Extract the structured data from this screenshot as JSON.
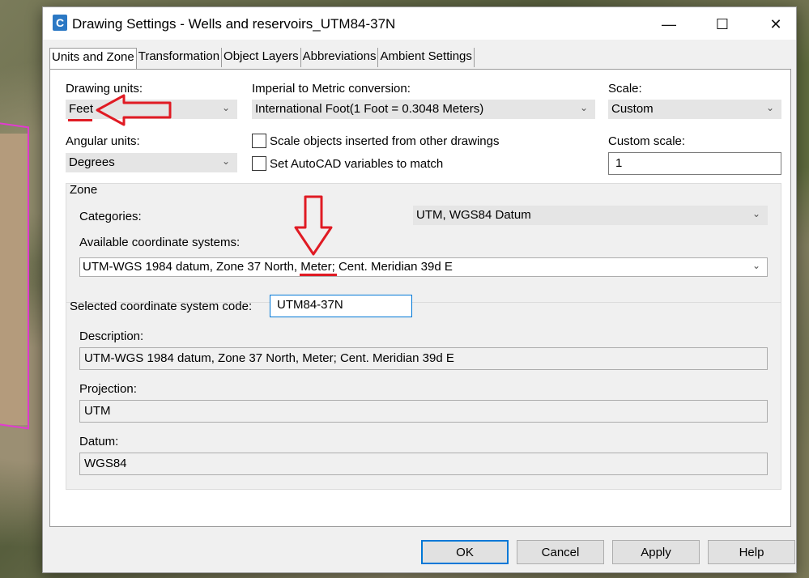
{
  "window": {
    "title": "Drawing Settings - Wells and reservoirs_UTM84-37N",
    "app_icon_letter": "C"
  },
  "tabs": [
    "Units and Zone",
    "Transformation",
    "Object Layers",
    "Abbreviations",
    "Ambient Settings"
  ],
  "units": {
    "drawing_units_label": "Drawing units:",
    "drawing_units_value": "Feet",
    "angular_units_label": "Angular units:",
    "angular_units_value": "Degrees",
    "conversion_label": "Imperial to Metric conversion:",
    "conversion_value": "International Foot(1 Foot = 0.3048 Meters)",
    "scale_objects_label": "Scale objects inserted from other drawings",
    "set_variables_label": "Set AutoCAD variables to match",
    "scale_label": "Scale:",
    "scale_value": "Custom",
    "custom_scale_label": "Custom scale:",
    "custom_scale_value": "1"
  },
  "zone": {
    "title": "Zone",
    "categories_label": "Categories:",
    "categories_value": "UTM, WGS84 Datum",
    "available_label": "Available coordinate systems:",
    "available_value": "UTM-WGS 1984 datum, Zone 37 North, Meter; Cent. Meridian 39d E",
    "selected_code_label": "Selected coordinate system code:",
    "selected_code_value": "UTM84-37N",
    "description_label": "Description:",
    "description_value": "UTM-WGS 1984 datum, Zone 37 North, Meter; Cent. Meridian 39d E",
    "projection_label": "Projection:",
    "projection_value": "UTM",
    "datum_label": "Datum:",
    "datum_value": "WGS84"
  },
  "buttons": {
    "ok": "OK",
    "cancel": "Cancel",
    "apply": "Apply",
    "help": "Help"
  },
  "colors": {
    "annotation_red": "#e01b24",
    "focus_blue": "#0078d7",
    "app_icon": "#2b78c4"
  }
}
